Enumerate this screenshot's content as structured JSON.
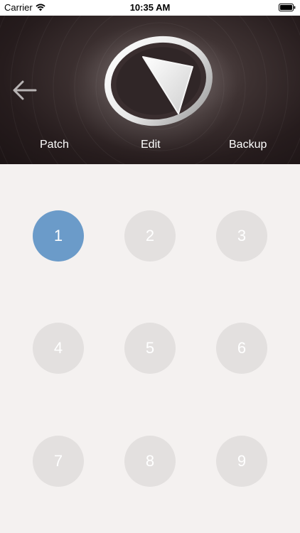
{
  "status_bar": {
    "carrier": "Carrier",
    "time": "10:35 AM"
  },
  "header": {
    "tabs": [
      {
        "label": "Patch"
      },
      {
        "label": "Edit"
      },
      {
        "label": "Backup"
      }
    ]
  },
  "slots": {
    "items": [
      {
        "label": "1",
        "selected": true
      },
      {
        "label": "2",
        "selected": false
      },
      {
        "label": "3",
        "selected": false
      },
      {
        "label": "4",
        "selected": false
      },
      {
        "label": "5",
        "selected": false
      },
      {
        "label": "6",
        "selected": false
      },
      {
        "label": "7",
        "selected": false
      },
      {
        "label": "8",
        "selected": false
      },
      {
        "label": "9",
        "selected": false
      }
    ]
  },
  "colors": {
    "selected_slot": "#6b9bc9",
    "slot": "#e3e0df",
    "background": "#f4f1f0",
    "header_dark": "#261c1d"
  },
  "icons": {
    "back": "arrow-left-icon",
    "logo": "play-ring-logo-icon",
    "wifi": "wifi-icon",
    "battery": "battery-icon"
  }
}
